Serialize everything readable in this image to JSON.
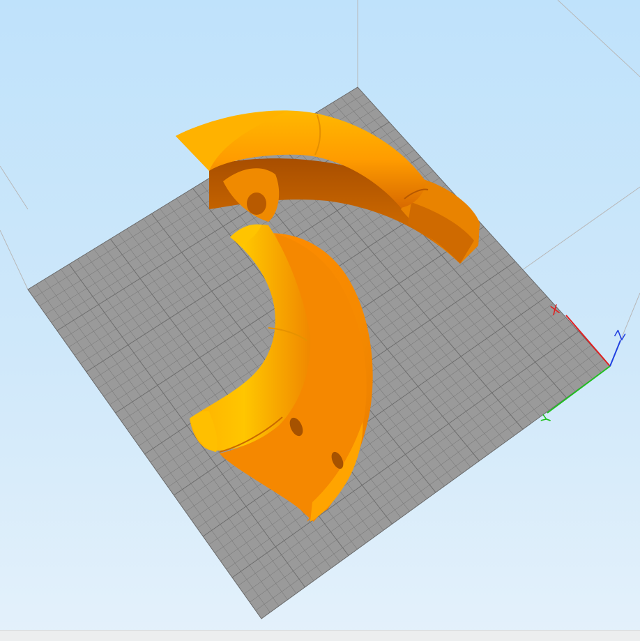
{
  "viewport": {
    "background_top": "#bfe2fb",
    "background_bottom": "#e4f1fb",
    "bed_color": "#9a9a9a",
    "grid_line_color": "#7a7a7a",
    "model_color": "#ff9a00",
    "model_highlight": "#ffc000",
    "model_shadow": "#c25d00"
  },
  "axes": {
    "x_label": "X",
    "y_label": "Y",
    "z_label": "Z",
    "x_color": "#e02020",
    "y_color": "#20c020",
    "z_color": "#2040e0"
  }
}
